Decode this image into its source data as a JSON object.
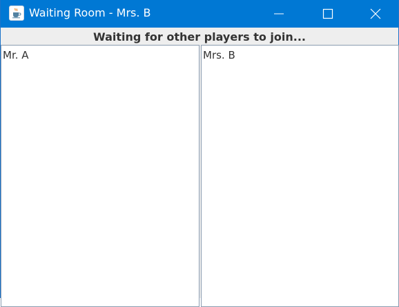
{
  "window": {
    "title": "Waiting Room - Mrs. B",
    "app_icon": "java-cup-icon",
    "controls": [
      "minimize-icon",
      "maximize-icon",
      "close-icon"
    ],
    "titlebar_color": "#0078d4"
  },
  "heading": "Waiting for other players to join...",
  "players": [
    {
      "name": "Mr. A"
    },
    {
      "name": "Mrs. B"
    }
  ]
}
